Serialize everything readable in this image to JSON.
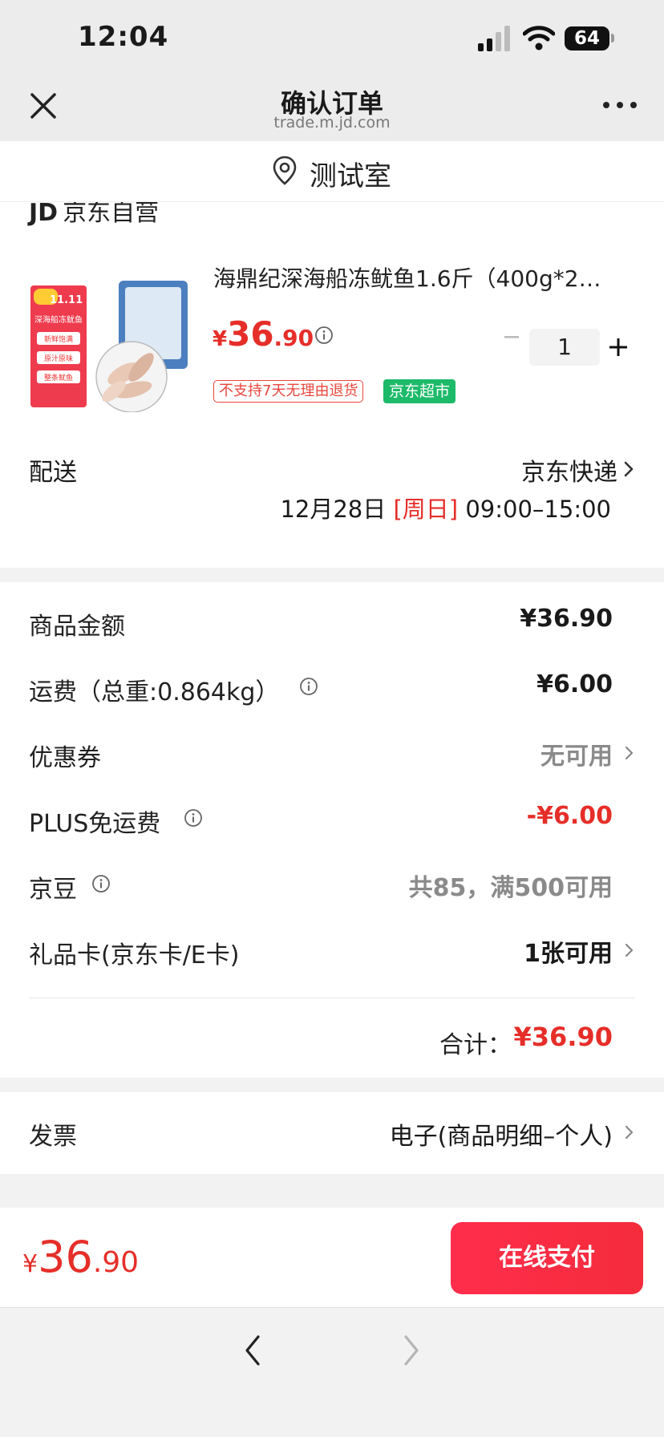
{
  "status_bar": {
    "time": "12:04",
    "battery": "64"
  },
  "nav": {
    "title": "确认订单",
    "url": "trade.m.jd.com"
  },
  "address": {
    "text": "测试室"
  },
  "shop": {
    "logo": "JD",
    "name": "京东自营"
  },
  "product": {
    "title": "海鼎纪深海船冻鱿鱼1.6斤（400g*2…",
    "price_symbol": "¥",
    "price_int": "36",
    "price_dec": ".90",
    "quantity": "1",
    "tag_return": "不支持7天无理由退货",
    "tag_market": "京东超市",
    "image_texts": [
      "11.11",
      "深海船冻鱿鱼",
      "新鲜饱满",
      "原汁原味",
      "整条鱿鱼"
    ]
  },
  "shipping": {
    "label": "配送",
    "method": "京东快递",
    "date_prefix": "12月28日 ",
    "date_day": "[周日]",
    "date_time": " 09:00–15:00"
  },
  "amounts": {
    "goods_label": "商品金额",
    "goods_value": "¥36.90",
    "freight_label": "运费（总重:0.864kg）",
    "freight_value": "¥6.00",
    "coupon_label": "优惠券",
    "coupon_value": "无可用",
    "plus_label": "PLUS免运费",
    "plus_value": "-¥6.00",
    "beans_label": "京豆",
    "beans_value": "共85，满500可用",
    "giftcard_label": "礼品卡(京东卡/E卡)",
    "giftcard_value": "1张可用",
    "total_label": "合计：",
    "total_value": "¥36.90"
  },
  "invoice": {
    "label": "发票",
    "value": "电子(商品明细–个人)"
  },
  "pay": {
    "symbol": "¥",
    "int": "36",
    "dec": ".90",
    "button": "在线支付"
  },
  "colors": {
    "accent": "#e62e29",
    "pay_button": "#ff2d4b",
    "market_tag": "#1dba6a"
  }
}
